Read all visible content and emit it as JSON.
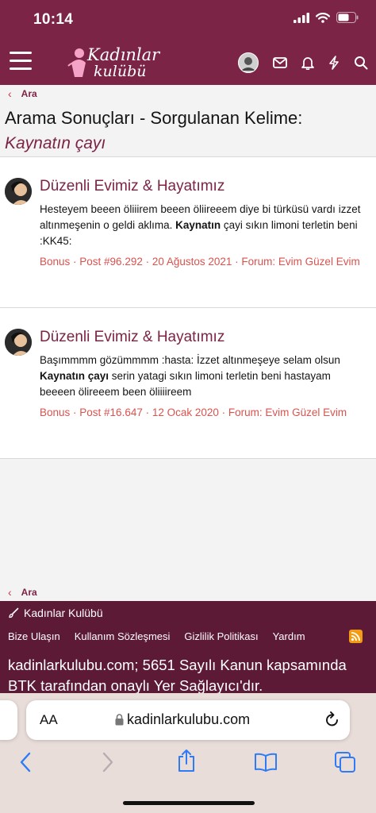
{
  "status": {
    "time": "10:14"
  },
  "nav": {
    "logo_line1": "Kadınlar",
    "logo_line2": "kulübü"
  },
  "breadcrumb": {
    "label": "Ara"
  },
  "page": {
    "title": "Arama Sonuçları - Sorgulanan Kelime:",
    "query": "Kaynatın çayı"
  },
  "results": [
    {
      "title": "Düzenli Evimiz & Hayatımız",
      "body_pre": "Hesteyem beeen öliiirem beeen öliireeem diye bi türküsü vardı izzet altınmeşenin o geldi aklıma. ",
      "body_bold": "Kaynatın",
      "body_post": " çayi sıkın limoni terletin beni :KK45:",
      "meta": "Bonus · Post #96.292 · 20 Ağustos 2021 · Forum: Evim Güzel Evim"
    },
    {
      "title": "Düzenli Evimiz & Hayatımız",
      "body_pre": "Başımmmm gözümmmm :hasta: İzzet altınmeşeye selam olsun ",
      "body_bold": "Kaynatın çayı",
      "body_post": " serin yatagi sıkın limoni terletin beni hastayam beeeen ölireeem been öliiiireem",
      "meta": "Bonus · Post #16.647 · 12 Ocak 2020 · Forum: Evim Güzel Evim"
    }
  ],
  "footer": {
    "brand": "Kadınlar Kulübü",
    "links": [
      "Bize Ulaşın",
      "Kullanım Sözleşmesi",
      "Gizlilik Politikası",
      "Yardım"
    ],
    "legal": "kadinlarkulubu.com; 5651 Sayılı Kanun kapsamında BTK tarafından onaylı Yer Sağlayıcı'dır."
  },
  "safari": {
    "aa_label": "AA",
    "url": "kadinlarkulubu.com"
  },
  "colors": {
    "brand": "#7b2446",
    "footer": "#5d1a36",
    "meta": "#d9534f"
  },
  "icons": [
    "hamburger-icon",
    "mail-icon",
    "bell-icon",
    "bolt-icon",
    "search-icon",
    "lock-icon",
    "reload-icon",
    "back-icon",
    "forward-icon",
    "share-icon",
    "bookmarks-icon",
    "tabs-icon",
    "rss-icon",
    "brush-icon"
  ]
}
